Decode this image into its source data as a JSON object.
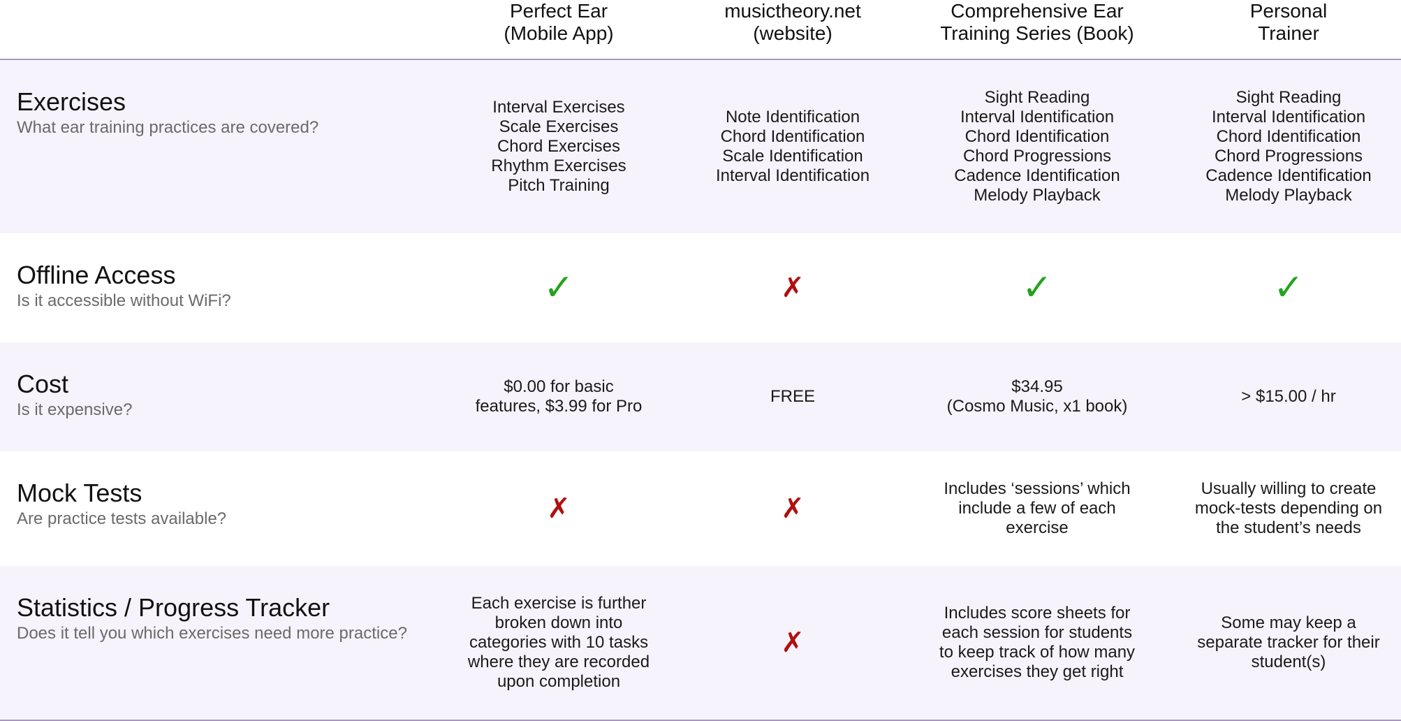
{
  "columns": [
    "Perfect Ear\n(Mobile App)",
    "musictheory.net\n(website)",
    "Comprehensive Ear\nTraining Series (Book)",
    "Personal\nTrainer"
  ],
  "rows": [
    {
      "title": "Exercises",
      "subtitle": "What ear training practices are covered?",
      "cells": [
        "Interval Exercises\nScale Exercises\nChord Exercises\nRhythm Exercises\nPitch Training",
        "Note Identification\nChord Identification\nScale Identification\nInterval Identification",
        "Sight Reading\nInterval Identification\nChord Identification\nChord Progressions\nCadence Identification\nMelody Playback",
        "Sight Reading\nInterval Identification\nChord Identification\nChord Progressions\nCadence Identification\nMelody Playback"
      ]
    },
    {
      "title": "Offline Access",
      "subtitle": "Is it accessible without WiFi?",
      "cells": [
        "✓",
        "✗",
        "✓",
        "✓"
      ]
    },
    {
      "title": "Cost",
      "subtitle": "Is it expensive?",
      "cells": [
        "$0.00 for basic\nfeatures, $3.99 for Pro",
        "FREE",
        "$34.95\n(Cosmo Music, x1 book)",
        "> $15.00 / hr"
      ]
    },
    {
      "title": "Mock Tests",
      "subtitle": "Are practice tests available?",
      "cells": [
        "✗",
        "✗",
        "Includes ‘sessions’ which\ninclude a few of each\nexercise",
        "Usually willing to create\nmock-tests depending on\nthe student’s needs"
      ]
    },
    {
      "title": "Statistics / Progress Tracker",
      "subtitle": "Does it tell you which exercises need more practice?",
      "cells": [
        "Each exercise is further\nbroken down into\ncategories with 10 tasks\nwhere they are recorded\nupon completion",
        "✗",
        "Includes score sheets for\neach session for students\nto keep track of how many\nexercises they get right",
        "Some may keep a\nseparate tracker for their\nstudent(s)"
      ]
    }
  ],
  "colors": {
    "yes": "#23a31e",
    "no": "#b01010",
    "row_shade": "#f6f3fc",
    "divider": "#a898c0"
  }
}
